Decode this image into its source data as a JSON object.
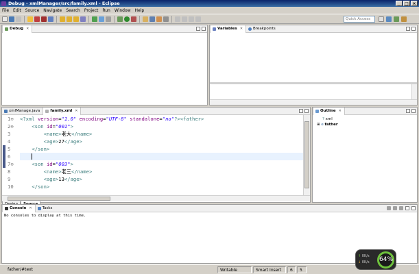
{
  "window": {
    "title": "Debug - xmlManager/src/family.xml - Eclipse",
    "controls": [
      "_",
      "□",
      "×"
    ]
  },
  "menu": [
    "File",
    "Edit",
    "Source",
    "Navigate",
    "Search",
    "Project",
    "Run",
    "Window",
    "Help"
  ],
  "toolbar": {
    "quick_access_placeholder": "Quick Access"
  },
  "debug_view": {
    "tab_label": "Debug"
  },
  "variables_view": {
    "tabs": [
      "Variables",
      "Breakpoints"
    ]
  },
  "editor": {
    "tabs": [
      "xmlManage.java",
      "family.xml"
    ],
    "lines": [
      {
        "num": "1",
        "marker": "⊖"
      },
      {
        "num": "2",
        "marker": "⊖"
      },
      {
        "num": "3",
        "marker": ""
      },
      {
        "num": "4",
        "marker": ""
      },
      {
        "num": "5",
        "marker": ""
      },
      {
        "num": "6",
        "marker": ""
      },
      {
        "num": "7",
        "marker": "⊖"
      },
      {
        "num": "8",
        "marker": ""
      },
      {
        "num": "9",
        "marker": ""
      },
      {
        "num": "10",
        "marker": ""
      }
    ],
    "code": {
      "l1_pi_open": "<?xml ",
      "l1_attr1": "version",
      "l1_val1": "\"1.0\"",
      "l1_attr2": "encoding",
      "l1_val2": "\"UTF-8\"",
      "l1_attr3": "standalone",
      "l1_val3": "\"no\"",
      "l1_pi_close": "?>",
      "l1_father": "<father>",
      "l2_open": "<son ",
      "l2_attr": "id",
      "l2_val": "\"001\"",
      "l2_close": ">",
      "l3_open": "<name>",
      "l3_text": "老大",
      "l3_close": "</name>",
      "l4_open": "<age>",
      "l4_text": "27",
      "l4_close": "</age>",
      "l5": "</son>",
      "l7_open": "<son ",
      "l7_attr": "id",
      "l7_val": "\"003\"",
      "l7_close": ">",
      "l8_open": "<name>",
      "l8_text": "老三",
      "l8_close": "</name>",
      "l9_open": "<age>",
      "l9_text": "13",
      "l9_close": "</age>",
      "l10": "</son>"
    },
    "bottom_tabs": [
      "Design",
      "Source"
    ]
  },
  "outline": {
    "tab_label": "Outline",
    "items": [
      {
        "label": "xml"
      },
      {
        "label": "father"
      }
    ]
  },
  "console": {
    "tabs": [
      "Console",
      "Tasks"
    ],
    "message": "No consoles to display at this time."
  },
  "status": {
    "path": "father/#text",
    "mode": "Writable",
    "insert": "Smart Insert",
    "line": "6",
    "col": "5"
  },
  "gauge": {
    "percent": "64%",
    "up": "0K/s",
    "down": "0K/s"
  },
  "colors": {
    "tag": "#3f7f7f",
    "attr": "#7f007f",
    "string": "#2a00ff",
    "current_line": "#e8f2fe",
    "gauge_ring": "#6ec23c"
  }
}
